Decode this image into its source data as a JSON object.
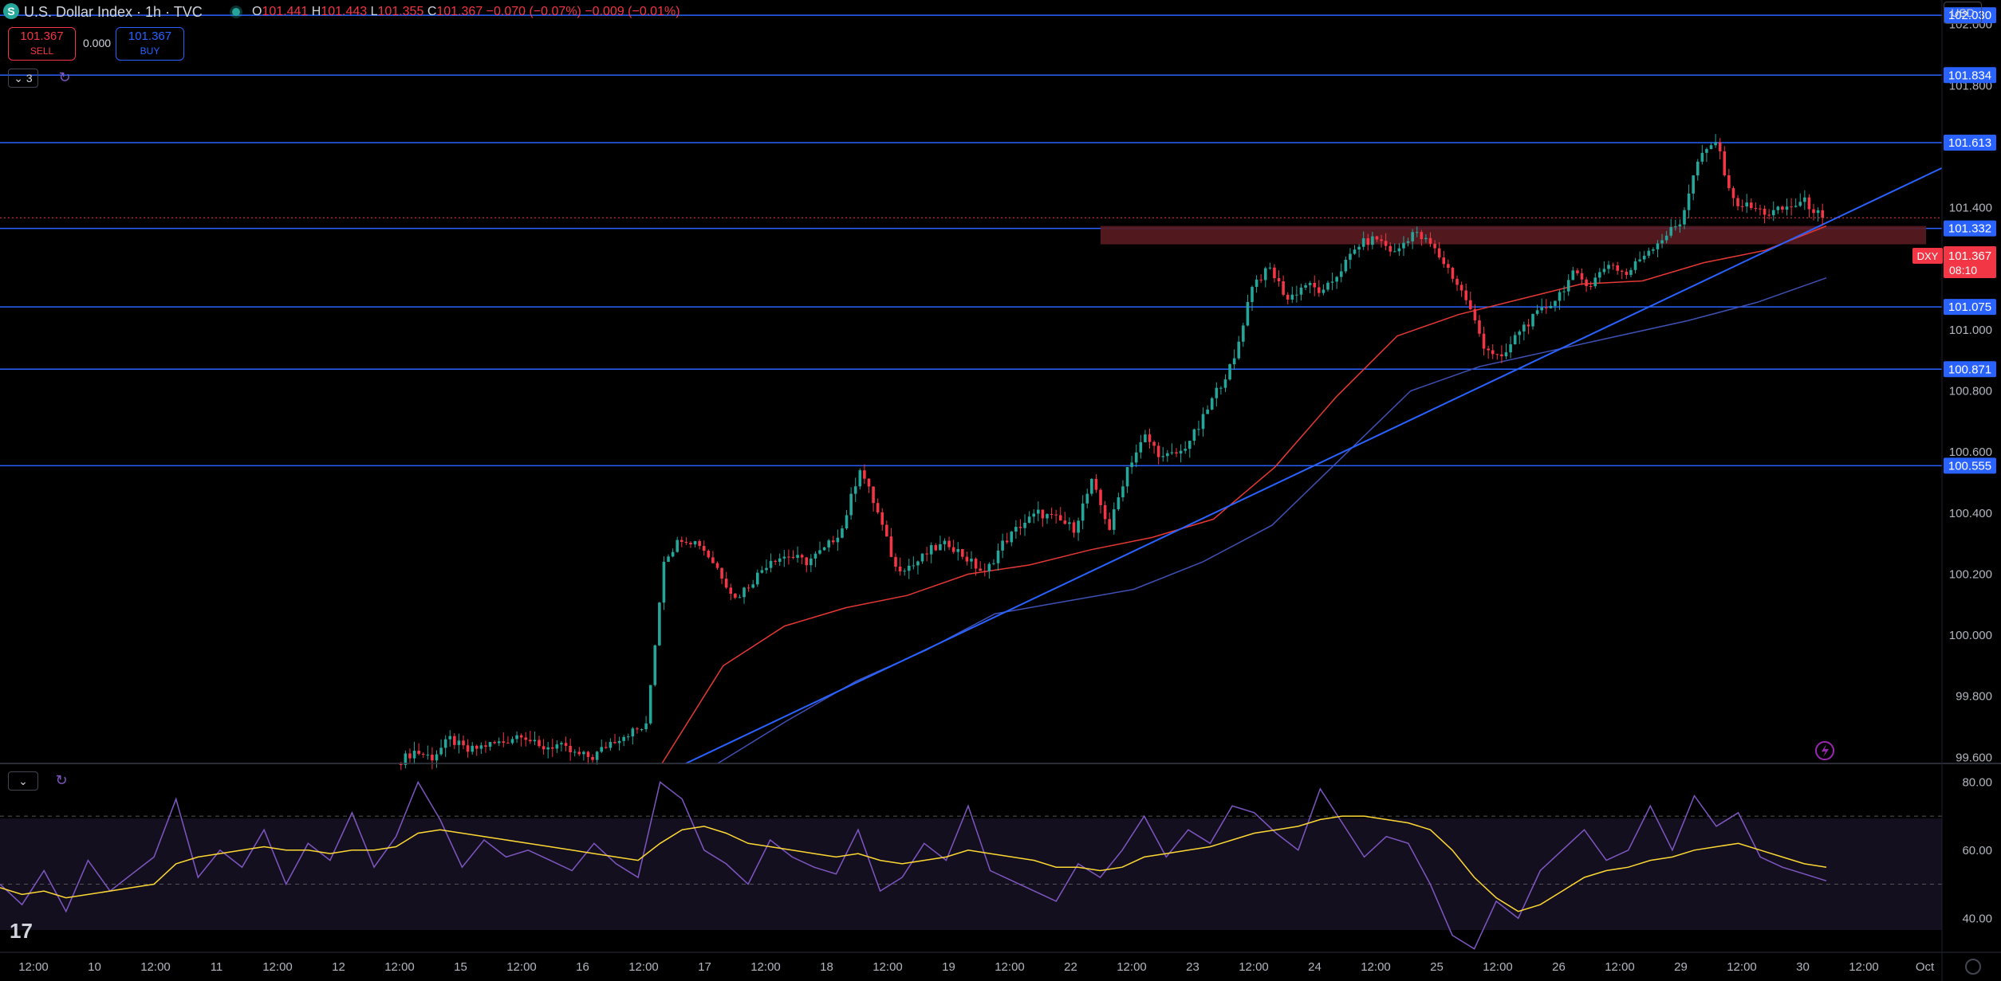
{
  "header": {
    "symbol_badge": "S",
    "title": "U.S. Dollar Index · 1h · TVC",
    "ohlc": {
      "o_label": "O",
      "o_value": "101.441",
      "h_label": "H",
      "h_value": "101.443",
      "l_label": "L",
      "l_value": "101.355",
      "c_label": "C",
      "c_value": "101.367",
      "change": "−0.070 (−0.07%)",
      "change2": "−0.009 (−0.01%)"
    },
    "currency": "USD"
  },
  "trade": {
    "sell_price": "101.367",
    "sell_label": "SELL",
    "spread": "0.000",
    "buy_price": "101.367",
    "buy_label": "BUY"
  },
  "indicators": {
    "collapsed_count": "3"
  },
  "price_axis": {
    "ticks": [
      "102.000",
      "101.800",
      "101.600",
      "101.400",
      "101.200",
      "101.000",
      "100.800",
      "100.600",
      "100.400",
      "100.200",
      "100.000",
      "99.800",
      "99.600"
    ],
    "level_labels": [
      "102.030",
      "101.834",
      "101.613",
      "101.332",
      "101.075",
      "100.871",
      "100.555"
    ],
    "current": {
      "symbol": "DXY",
      "price": "101.367",
      "countdown": "08:10"
    }
  },
  "rsi_axis": {
    "ticks": [
      "80.00",
      "60.00",
      "40.00"
    ]
  },
  "time_axis": {
    "ticks": [
      "12:00",
      "10",
      "12:00",
      "11",
      "12:00",
      "12",
      "12:00",
      "15",
      "12:00",
      "16",
      "12:00",
      "17",
      "12:00",
      "18",
      "12:00",
      "19",
      "12:00",
      "22",
      "12:00",
      "23",
      "12:00",
      "24",
      "12:00",
      "25",
      "12:00",
      "26",
      "12:00",
      "29",
      "12:00",
      "30",
      "12:00",
      "Oct"
    ]
  },
  "branding": {
    "logo_text": "17"
  },
  "colors": {
    "up": "#26a69a",
    "down": "#f23645",
    "level_line": "#2962ff",
    "ma_fast": "#e53935",
    "ma_slow": "#3f51b5",
    "rsi": "#7e57c2",
    "rsi_ma": "#fdd835",
    "zone": "#5a1b21",
    "background": "#000000"
  },
  "chart_data": {
    "type": "candlestick",
    "interval": "1h",
    "yrange": [
      99.58,
      102.08
    ],
    "horizontal_levels": [
      102.03,
      101.834,
      101.613,
      101.332,
      101.075,
      100.871,
      100.555
    ],
    "resistance_zone": [
      101.28,
      101.34
    ],
    "trendline": {
      "from_price": 99.58,
      "to_price": 101.53
    },
    "ma_fast": [
      99.58,
      99.9,
      100.03,
      100.09,
      100.13,
      100.2,
      100.23,
      100.28,
      100.32,
      100.38,
      100.55,
      100.78,
      100.98,
      101.05,
      101.1,
      101.15,
      101.16,
      101.22,
      101.26,
      101.34
    ],
    "ma_slow": [
      99.58,
      99.72,
      99.85,
      99.95,
      100.07,
      100.11,
      100.15,
      100.24,
      100.36,
      100.58,
      100.8,
      100.88,
      100.93,
      100.98,
      101.03,
      101.09,
      101.17
    ],
    "price_path": [
      99.58,
      99.62,
      99.6,
      99.66,
      99.62,
      99.64,
      99.65,
      99.68,
      99.63,
      99.64,
      99.61,
      99.6,
      99.65,
      99.68,
      99.7,
      100.25,
      100.32,
      100.3,
      100.22,
      100.12,
      100.18,
      100.25,
      100.26,
      100.24,
      100.28,
      100.35,
      100.55,
      100.4,
      100.22,
      100.23,
      100.28,
      100.3,
      100.25,
      100.2,
      100.3,
      100.36,
      100.4,
      100.38,
      100.35,
      100.5,
      100.35,
      100.55,
      100.65,
      100.58,
      100.6,
      100.68,
      100.8,
      100.9,
      101.15,
      101.2,
      101.1,
      101.15,
      101.12,
      101.2,
      101.28,
      101.3,
      101.25,
      101.32,
      101.28,
      101.2,
      101.1,
      100.95,
      100.9,
      101.0,
      101.05,
      101.1,
      101.18,
      101.15,
      101.22,
      101.18,
      101.25,
      101.3,
      101.35,
      101.55,
      101.62,
      101.42,
      101.4,
      101.38,
      101.4,
      101.42,
      101.367
    ],
    "rsi": {
      "yrange": [
        30,
        85
      ],
      "bands": [
        70,
        50,
        30
      ],
      "values": [
        50,
        44,
        54,
        42,
        57,
        48,
        53,
        58,
        75,
        52,
        60,
        55,
        66,
        50,
        62,
        57,
        71,
        55,
        64,
        80,
        69,
        55,
        63,
        58,
        60,
        57,
        54,
        62,
        56,
        52,
        80,
        75,
        60,
        56,
        50,
        63,
        58,
        55,
        53,
        66,
        48,
        52,
        62,
        57,
        73,
        54,
        51,
        48,
        45,
        56,
        52,
        60,
        70,
        58,
        66,
        62,
        73,
        71,
        65,
        60,
        78,
        68,
        58,
        64,
        62,
        50,
        35,
        31,
        45,
        40,
        54,
        60,
        66,
        57,
        60,
        73,
        60,
        76,
        67,
        71,
        58,
        55,
        53,
        51
      ],
      "ma_values": [
        49,
        47,
        48,
        46,
        47,
        48,
        49,
        50,
        56,
        58,
        59,
        60,
        61,
        60,
        60,
        59,
        60,
        60,
        61,
        65,
        66,
        65,
        64,
        63,
        62,
        61,
        60,
        59,
        58,
        57,
        62,
        66,
        67,
        65,
        62,
        61,
        60,
        59,
        58,
        59,
        57,
        56,
        57,
        58,
        60,
        59,
        58,
        57,
        55,
        55,
        54,
        55,
        58,
        59,
        60,
        61,
        63,
        65,
        66,
        67,
        69,
        70,
        70,
        69,
        68,
        66,
        60,
        52,
        46,
        42,
        44,
        48,
        52,
        54,
        55,
        57,
        58,
        60,
        61,
        62,
        60,
        58,
        56,
        55
      ]
    }
  }
}
